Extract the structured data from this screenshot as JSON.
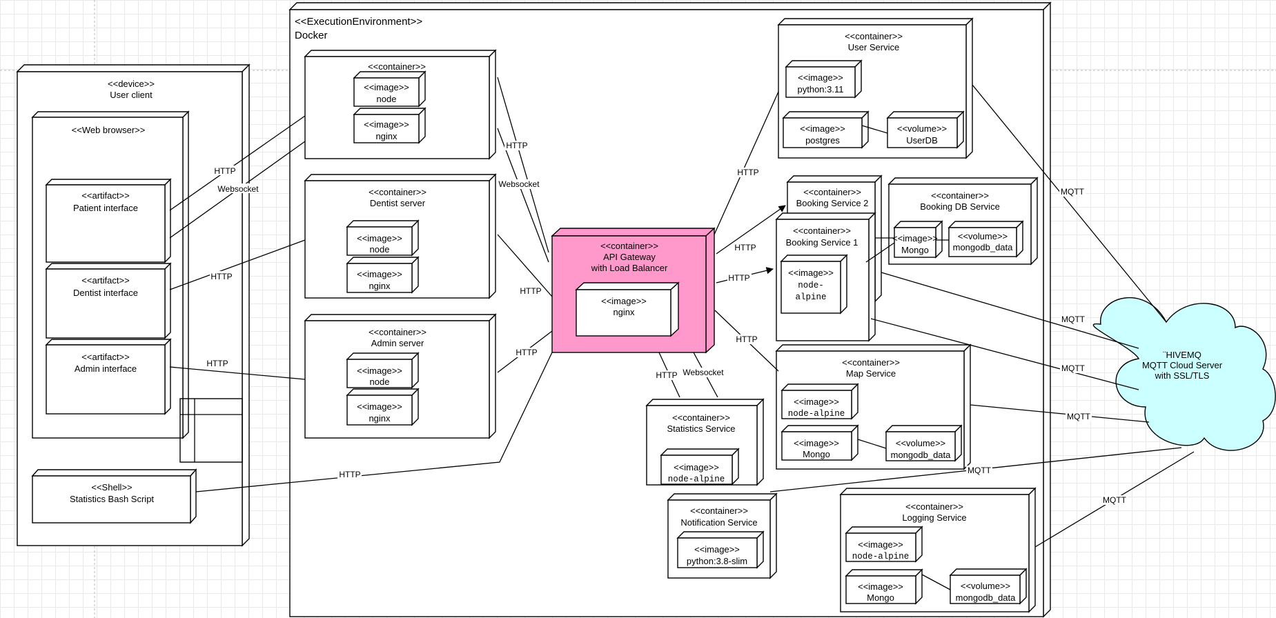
{
  "execution_environment": {
    "stereotype": "<<ExecutionEnvironment>>",
    "name": "Docker"
  },
  "device": {
    "stereotype": "<<device>>",
    "name": "User client"
  },
  "web_browser": {
    "stereotype": "<<Web browser>>"
  },
  "artifacts": {
    "patient": {
      "stereotype": "<<artifact>>",
      "name": "Patient interface"
    },
    "dentist": {
      "stereotype": "<<artifact>>",
      "name": "Dentist interface"
    },
    "admin": {
      "stereotype": "<<artifact>>",
      "name": "Admin interface"
    }
  },
  "shell": {
    "stereotype": "<<Shell>>",
    "name": "Statistics Bash Script"
  },
  "patient_server": {
    "stereotype": "<<container>>",
    "images": [
      {
        "stereotype": "<<image>>",
        "name": "node"
      },
      {
        "stereotype": "<<image>>",
        "name": "nginx"
      }
    ]
  },
  "dentist_server": {
    "stereotype": "<<container>>",
    "name": "Dentist server",
    "images": [
      {
        "stereotype": "<<image>>",
        "name": "node"
      },
      {
        "stereotype": "<<image>>",
        "name": "nginx"
      }
    ]
  },
  "admin_server": {
    "stereotype": "<<container>>",
    "name": "Admin server",
    "images": [
      {
        "stereotype": "<<image>>",
        "name": "node"
      },
      {
        "stereotype": "<<image>>",
        "name": "nginx"
      }
    ]
  },
  "api_gateway": {
    "stereotype": "<<container>>",
    "name_line1": "API Gateway",
    "name_line2": "with Load Balancer",
    "image": {
      "stereotype": "<<image>>",
      "name": "nginx"
    }
  },
  "user_service": {
    "stereotype": "<<container>>",
    "name": "User Service",
    "image1": {
      "stereotype": "<<image>>",
      "name": "python:3.11"
    },
    "image2": {
      "stereotype": "<<image>>",
      "name": "postgres"
    },
    "volume": {
      "stereotype": "<<volume>>",
      "name": "UserDB"
    }
  },
  "booking_service_2": {
    "stereotype": "<<container>>",
    "name": "Booking Service 2"
  },
  "booking_service_1": {
    "stereotype": "<<container>>",
    "name": "Booking Service 1",
    "image": {
      "stereotype": "<<image>>",
      "name_line1": "node-",
      "name_line2": "alpine"
    }
  },
  "booking_db_service": {
    "stereotype": "<<container>>",
    "name": "Booking DB Service",
    "image": {
      "stereotype": "<<image>>",
      "name": "Mongo"
    },
    "volume": {
      "stereotype": "<<volume>>",
      "name": "mongodb_data"
    }
  },
  "map_service": {
    "stereotype": "<<container>>",
    "name": "Map Service",
    "image1": {
      "stereotype": "<<image>>",
      "name": "node-alpine"
    },
    "image2": {
      "stereotype": "<<image>>",
      "name": "Mongo"
    },
    "volume": {
      "stereotype": "<<volume>>",
      "name": "mongodb_data"
    }
  },
  "statistics_service": {
    "stereotype": "<<container>>",
    "name": "Statistics Service",
    "image": {
      "stereotype": "<<image>>",
      "name": "node-alpine"
    }
  },
  "notification_service": {
    "stereotype": "<<container>>",
    "name": "Notification Service",
    "image": {
      "stereotype": "<<image>>",
      "name": "python:3.8-slim"
    }
  },
  "logging_service": {
    "stereotype": "<<container>>",
    "name": "Logging Service",
    "image1": {
      "stereotype": "<<image>>",
      "name": "node-alpine"
    },
    "image2": {
      "stereotype": "<<image>>",
      "name": "Mongo"
    },
    "volume": {
      "stereotype": "<<volume>>",
      "name": "mongodb_data"
    }
  },
  "hivemq": {
    "line1": "¨HIVEMQ",
    "line2": "MQTT Cloud Server",
    "line3": "with SSL/TLS"
  },
  "edge_labels": {
    "http": "HTTP",
    "websocket": "Websocket",
    "mqtt": "MQTT"
  },
  "colors": {
    "gateway": "#ff99cc",
    "cloud": "#ccffff"
  }
}
